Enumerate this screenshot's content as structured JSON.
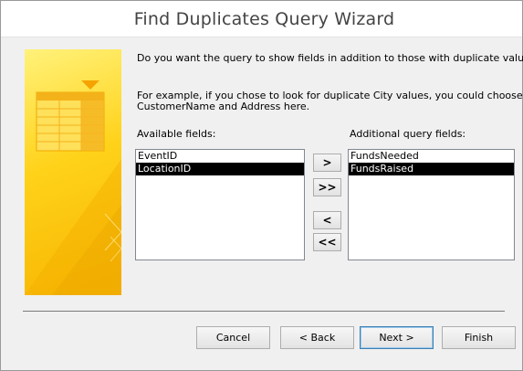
{
  "window": {
    "title": "Find Duplicates Query Wizard"
  },
  "instructions": {
    "question": "Do you want the query to show fields in addition to those with duplicate values?",
    "example_line1": "For example, if you chose to look for duplicate City values, you could choose",
    "example_line2": "CustomerName and Address here."
  },
  "available": {
    "label": "Available fields:",
    "items": [
      {
        "label": "EventID",
        "selected": false
      },
      {
        "label": "LocationID",
        "selected": true
      }
    ]
  },
  "additional": {
    "label": "Additional query fields:",
    "items": [
      {
        "label": "FundsNeeded",
        "selected": false
      },
      {
        "label": "FundsRaised",
        "selected": true
      }
    ]
  },
  "move_buttons": {
    "add_one": ">",
    "add_all": ">>",
    "remove_one": "<",
    "remove_all": "<<"
  },
  "footer": {
    "cancel_label": "Cancel",
    "back_label": "< Back",
    "next_label": "Next >",
    "finish_label": "Finish"
  }
}
